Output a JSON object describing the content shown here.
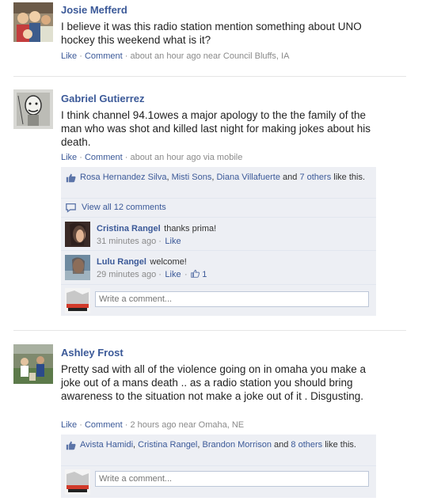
{
  "posts": [
    {
      "author": "Josie Mefferd",
      "text": "I believe it was this radio station mention something about UNO hockey this weekend what is it?",
      "like": "Like",
      "dot": "·",
      "comment": "Comment",
      "time": "· about an hour ago near Council Bluffs, IA"
    },
    {
      "author": "Gabriel Gutierrez",
      "text": "I think channel 94.1owes a major apology to the the family of the man who was shot and killed last night for making jokes about his death.",
      "like": "Like",
      "dot": "·",
      "comment": "Comment",
      "time": "· about an hour ago via mobile",
      "likers": [
        "Rosa Hernandez Silva",
        "Misti Sons",
        "Diana Villafuerte"
      ],
      "likes_sep": ",",
      "likes_and": "and",
      "likes_others": "7 others",
      "likes_tail": "like this.",
      "view_all": "View all 12 comments",
      "comments": [
        {
          "name": "Cristina Rangel",
          "text": "thanks prima!",
          "time": "31 minutes ago ·",
          "like": "Like"
        },
        {
          "name": "Lulu Rangel",
          "text": "welcome!",
          "time": "29 minutes ago ·",
          "like": "Like",
          "sep": "·",
          "like_count": "1"
        }
      ],
      "write_placeholder": "Write a comment..."
    },
    {
      "author": "Ashley Frost",
      "text": "Pretty sad with all of the violence going on in omaha you make a joke out of a mans death .. as a radio station you should bring awareness to the situation not make a joke out of it . Disgusting.",
      "like": "Like",
      "dot": "·",
      "comment": "Comment",
      "time": "· 2 hours ago near Omaha, NE",
      "likers": [
        "Avista Hamidi",
        "Cristina Rangel",
        "Brandon Morrison"
      ],
      "likes_sep": ",",
      "likes_and": "and",
      "likes_others": "8 others",
      "likes_tail": "like this.",
      "write_placeholder": "Write a comment..."
    }
  ],
  "colors": {
    "link": "#3b5998",
    "ufi_bg": "#edeff4",
    "meta": "#8a8a8a"
  },
  "icons": [
    "thumbs-up-icon",
    "comment-bubble-icon",
    "user-avatar-icon"
  ]
}
